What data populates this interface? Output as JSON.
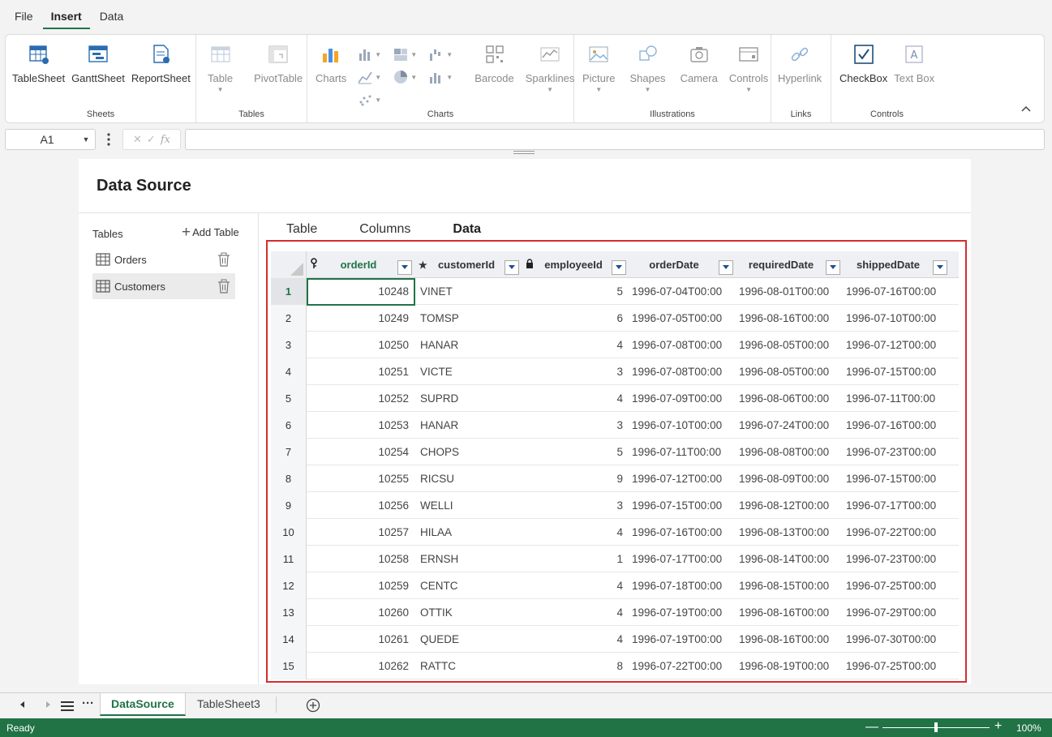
{
  "menu": {
    "items": [
      "File",
      "Insert",
      "Data"
    ],
    "active": "Insert"
  },
  "ribbon": {
    "groups": {
      "sheets": {
        "label": "Sheets",
        "buttons": [
          "TableSheet",
          "GanttSheet",
          "ReportSheet"
        ]
      },
      "tables": {
        "label": "Tables",
        "buttons": [
          "Table",
          "PivotTable"
        ]
      },
      "charts": {
        "label": "Charts",
        "buttons": [
          "Charts",
          "Barcode",
          "Sparklines"
        ]
      },
      "illustrations": {
        "label": "Illustrations",
        "buttons": [
          "Picture",
          "Shapes",
          "Camera",
          "Controls"
        ]
      },
      "links": {
        "label": "Links",
        "buttons": [
          "Hyperlink"
        ]
      },
      "controls": {
        "label": "Controls",
        "buttons": [
          "CheckBox",
          "Text Box"
        ]
      }
    }
  },
  "formula_bar": {
    "name_box": "A1",
    "fx": "fx",
    "cancel": "✕",
    "confirm": "✓",
    "formula": ""
  },
  "data_source": {
    "title": "Data Source",
    "tables_label": "Tables",
    "add_table_label": "Add Table",
    "tables": [
      {
        "name": "Orders",
        "selected": false
      },
      {
        "name": "Customers",
        "selected": true
      }
    ],
    "tabs": [
      "Table",
      "Columns",
      "Data"
    ],
    "active_tab": "Data",
    "columns": [
      {
        "label": "orderId",
        "prefix": "key-icon"
      },
      {
        "label": "customerId",
        "prefix": "star-icon"
      },
      {
        "label": "employeeId",
        "prefix": "lock-icon"
      },
      {
        "label": "orderDate",
        "prefix": ""
      },
      {
        "label": "requiredDate",
        "prefix": ""
      },
      {
        "label": "shippedDate",
        "prefix": ""
      }
    ],
    "rows": [
      {
        "n": "1",
        "orderId": "10248",
        "customerId": "VINET",
        "employeeId": "5",
        "orderDate": "1996-07-04T00:00",
        "requiredDate": "1996-08-01T00:00",
        "shippedDate": "1996-07-16T00:00"
      },
      {
        "n": "2",
        "orderId": "10249",
        "customerId": "TOMSP",
        "employeeId": "6",
        "orderDate": "1996-07-05T00:00",
        "requiredDate": "1996-08-16T00:00",
        "shippedDate": "1996-07-10T00:00"
      },
      {
        "n": "3",
        "orderId": "10250",
        "customerId": "HANAR",
        "employeeId": "4",
        "orderDate": "1996-07-08T00:00",
        "requiredDate": "1996-08-05T00:00",
        "shippedDate": "1996-07-12T00:00"
      },
      {
        "n": "4",
        "orderId": "10251",
        "customerId": "VICTE",
        "employeeId": "3",
        "orderDate": "1996-07-08T00:00",
        "requiredDate": "1996-08-05T00:00",
        "shippedDate": "1996-07-15T00:00"
      },
      {
        "n": "5",
        "orderId": "10252",
        "customerId": "SUPRD",
        "employeeId": "4",
        "orderDate": "1996-07-09T00:00",
        "requiredDate": "1996-08-06T00:00",
        "shippedDate": "1996-07-11T00:00"
      },
      {
        "n": "6",
        "orderId": "10253",
        "customerId": "HANAR",
        "employeeId": "3",
        "orderDate": "1996-07-10T00:00",
        "requiredDate": "1996-07-24T00:00",
        "shippedDate": "1996-07-16T00:00"
      },
      {
        "n": "7",
        "orderId": "10254",
        "customerId": "CHOPS",
        "employeeId": "5",
        "orderDate": "1996-07-11T00:00",
        "requiredDate": "1996-08-08T00:00",
        "shippedDate": "1996-07-23T00:00"
      },
      {
        "n": "8",
        "orderId": "10255",
        "customerId": "RICSU",
        "employeeId": "9",
        "orderDate": "1996-07-12T00:00",
        "requiredDate": "1996-08-09T00:00",
        "shippedDate": "1996-07-15T00:00"
      },
      {
        "n": "9",
        "orderId": "10256",
        "customerId": "WELLI",
        "employeeId": "3",
        "orderDate": "1996-07-15T00:00",
        "requiredDate": "1996-08-12T00:00",
        "shippedDate": "1996-07-17T00:00"
      },
      {
        "n": "10",
        "orderId": "10257",
        "customerId": "HILAA",
        "employeeId": "4",
        "orderDate": "1996-07-16T00:00",
        "requiredDate": "1996-08-13T00:00",
        "shippedDate": "1996-07-22T00:00"
      },
      {
        "n": "11",
        "orderId": "10258",
        "customerId": "ERNSH",
        "employeeId": "1",
        "orderDate": "1996-07-17T00:00",
        "requiredDate": "1996-08-14T00:00",
        "shippedDate": "1996-07-23T00:00"
      },
      {
        "n": "12",
        "orderId": "10259",
        "customerId": "CENTC",
        "employeeId": "4",
        "orderDate": "1996-07-18T00:00",
        "requiredDate": "1996-08-15T00:00",
        "shippedDate": "1996-07-25T00:00"
      },
      {
        "n": "13",
        "orderId": "10260",
        "customerId": "OTTIK",
        "employeeId": "4",
        "orderDate": "1996-07-19T00:00",
        "requiredDate": "1996-08-16T00:00",
        "shippedDate": "1996-07-29T00:00"
      },
      {
        "n": "14",
        "orderId": "10261",
        "customerId": "QUEDE",
        "employeeId": "4",
        "orderDate": "1996-07-19T00:00",
        "requiredDate": "1996-08-16T00:00",
        "shippedDate": "1996-07-30T00:00"
      },
      {
        "n": "15",
        "orderId": "10262",
        "customerId": "RATTC",
        "employeeId": "8",
        "orderDate": "1996-07-22T00:00",
        "requiredDate": "1996-08-19T00:00",
        "shippedDate": "1996-07-25T00:00"
      }
    ]
  },
  "sheets": {
    "tabs": [
      "DataSource",
      "TableSheet3"
    ],
    "active": "DataSource"
  },
  "status": {
    "text": "Ready",
    "zoom": "100%",
    "zoom_minus": "—",
    "zoom_plus": "+"
  },
  "colors": {
    "accent": "#217346",
    "highlight_border": "#d62c2c"
  }
}
